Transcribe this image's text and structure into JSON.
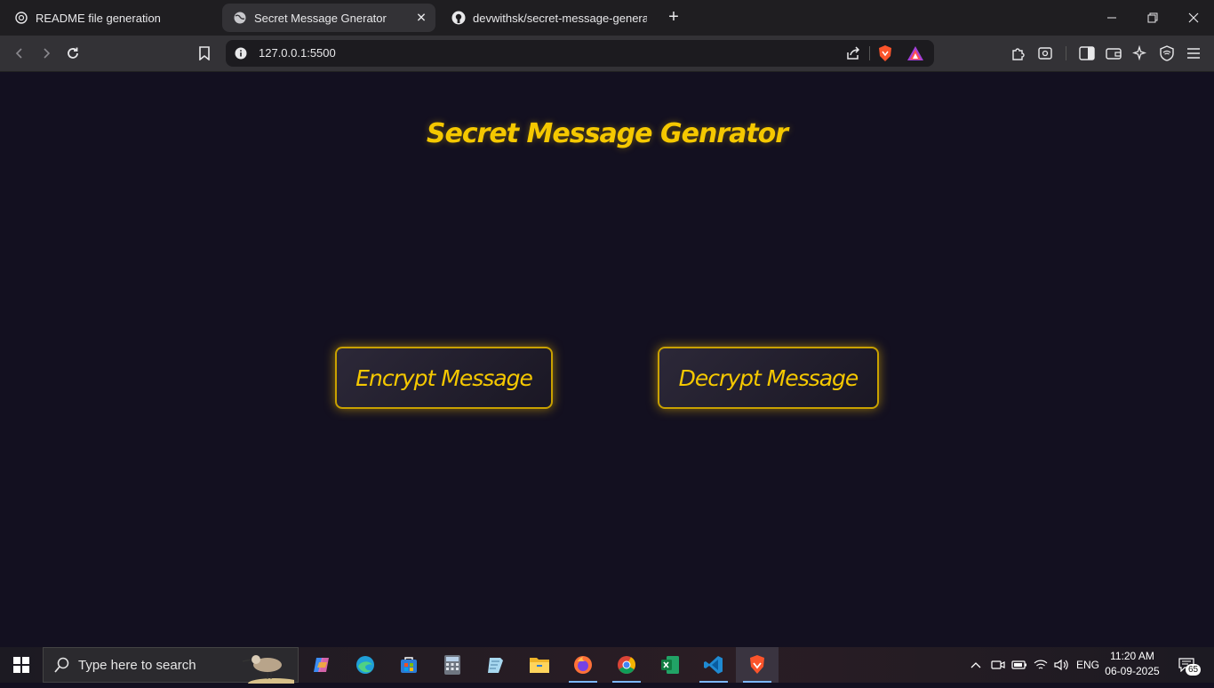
{
  "browser": {
    "tabs": [
      {
        "title": "README file generation",
        "icon": "openai-icon"
      },
      {
        "title": "Secret Message Gnerator",
        "icon": "globe-icon",
        "active": true
      },
      {
        "title": "devwithsk/secret-message-generator",
        "icon": "github-icon"
      }
    ],
    "new_tab": "+",
    "address": "127.0.0.1:5500"
  },
  "page": {
    "title": "Secret Message Genrator",
    "encrypt_label": "Encrypt Message",
    "decrypt_label": "Decrypt Message",
    "accent_color": "#f5c800",
    "background_color": "#131020"
  },
  "taskbar": {
    "search_placeholder": "Type here to search",
    "apps": [
      "copilot-icon",
      "edge-icon",
      "store-icon",
      "calculator-icon",
      "notepad-icon",
      "file-explorer-icon",
      "firefox-icon",
      "chrome-icon",
      "excel-icon",
      "vscode-icon",
      "brave-icon"
    ],
    "language": "ENG",
    "time": "11:20 AM",
    "date": "06-09-2025",
    "notification_count": "65"
  }
}
